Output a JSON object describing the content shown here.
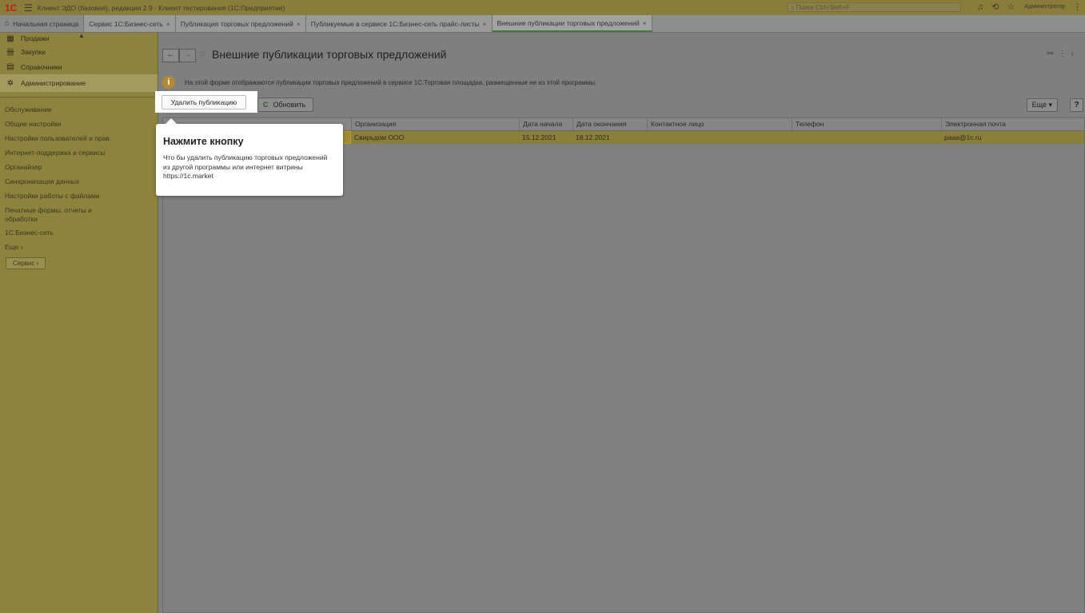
{
  "window": {
    "logo": "1С",
    "title": "Клиент ЭДО (базовая), редакция 2.9  - Клиент тестирования (1С:Предприятие)",
    "search_placeholder": "Поиск Ctrl+Shift+F",
    "user": "Администратор"
  },
  "tabs": [
    {
      "label": "Начальная страница"
    },
    {
      "label": "Сервис 1С:Бизнес-сеть"
    },
    {
      "label": "Публикация торговых предложений"
    },
    {
      "label": "Публикуемые в сервисе 1С:Бизнес-сеть прайс-листы"
    },
    {
      "label": "Внешние публикации торговых предложений"
    }
  ],
  "sidebar": {
    "sections": [
      {
        "label": "Продажи",
        "icon": "sales-icon"
      },
      {
        "label": "Закупки",
        "icon": "purchases-icon"
      },
      {
        "label": "Справочники",
        "icon": "catalogs-icon"
      },
      {
        "label": "Администрирование",
        "icon": "gear-icon"
      }
    ],
    "items": [
      "Обслуживание",
      "Общие настройки",
      "Настройки пользователей и прав",
      "Интернет-поддержка и сервисы",
      "Органайзер",
      "Синхронизация данных",
      "Настройки работы с файлами",
      "Печатные формы, отчеты и обработки",
      "1С:Бизнес-сеть",
      "Еще ›"
    ],
    "service_button": "Сервис ›"
  },
  "form": {
    "title": "Внешние публикации торговых предложений",
    "info": "На этой форме отображаются публикации торговых предложений в сервисе 1С:Торговая площадка, размещенные не из этой программы.",
    "delete_button": "Удалить публикацию",
    "refresh_button": "Обновить",
    "more_button": "Еще ▾",
    "help_button": "?"
  },
  "table": {
    "columns": [
      "",
      "Организация",
      "Дата начала",
      "Дата окончания",
      "Контактное лицо",
      "Телефон",
      "Электронная почта"
    ],
    "rows": [
      [
        "",
        "Свирьдом ООО",
        "15.12.2021",
        "18.12.2021",
        "",
        "",
        "paaa@1c.ru"
      ]
    ]
  },
  "tooltip": {
    "heading": "Нажмите кнопку",
    "body": "Что бы удалить публикацию торговых предложений из другой программы или интернет витрины https://1c.market"
  },
  "colors": {
    "accent": "#3e7a3e",
    "sidebar": "#8d833e",
    "selected_row": "#8a7f38"
  }
}
